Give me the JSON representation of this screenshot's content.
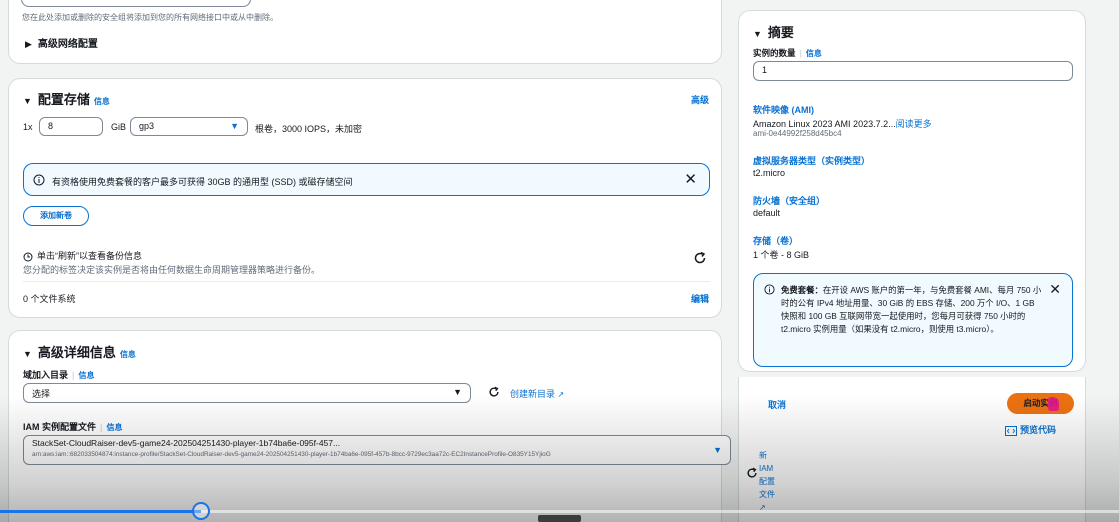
{
  "top_section": {
    "hint_text": "您在此处添加或删除的安全组将添加到您的所有网络接口中或从中删除。",
    "advanced_network_label": "高级网络配置"
  },
  "storage": {
    "title": "配置存储",
    "info": "信息",
    "advanced": "高级",
    "prefix": "1x",
    "size_value": "8",
    "unit": "GiB",
    "volume_type": "gp3",
    "volume_desc": "根卷，3000 IOPS，未加密",
    "alert_text": "有资格使用免费套餐的客户最多可获得 30GB 的通用型 (SSD) 或磁存储空间",
    "add_volume": "添加新卷",
    "backup_title": "单击“刷新”以查看备份信息",
    "backup_desc": "您分配的标签决定该实例是否将由任何数据生命周期管理器策略进行备份。",
    "fs_count": "0 个文件系统",
    "edit": "编辑"
  },
  "advanced_details": {
    "title": "高级详细信息",
    "info": "信息",
    "domain_label": "域加入目录",
    "domain_info": "信息",
    "domain_select": "选择",
    "create_dir": "创建新目录",
    "iam_label": "IAM 实例配置文件",
    "iam_info": "信息",
    "iam_value": "StackSet-CloudRaiser-dev5-game24-202504251430-player-1b74ba6e-095f-457...",
    "iam_arn": "arn:aws:iam::682033504874:instance-profile/StackSet-CloudRaiser-dev5-game24-202504251430-player-1b74ba6e-095f-457b-8bcc-9729ec3aa72c-EC2InstanceProfile-O835Y15YjioG",
    "new_iam_lines": [
      "新",
      "IAM",
      "配置",
      "文件"
    ]
  },
  "summary": {
    "title": "摘要",
    "instances_label": "实例的数量",
    "instances_info": "信息",
    "instances_value": "1",
    "software_label": "软件映像 (AMI)",
    "software_value": "Amazon Linux 2023 AMI 2023.7.2...",
    "read_more": "阅读更多",
    "ami_id": "ami-0e44992f258d45bc4",
    "server_type_label": "虚拟服务器类型（实例类型）",
    "server_type_value": "t2.micro",
    "firewall_label": "防火墙（安全组）",
    "firewall_value": "default",
    "storage_label": "存储（卷）",
    "storage_value": "1 个卷 - 8 GiB",
    "free_tier_bold": "免费套餐：",
    "free_tier_text": "在开设 AWS 账户的第一年，与免费套餐 AMI、每月 750 小时的公有 IPv4 地址用量、30 GiB 的 EBS 存储、200 万个 I/O、1 GB 快照和 100 GB 互联网带宽一起使用时，您每月可获得 750 小时的 t2.micro 实例用量（如果没有 t2.micro，则使用 t3.micro）。",
    "cancel": "取消",
    "launch": "启动实例",
    "preview_code": "预览代码"
  },
  "video_progress": 0.18,
  "colors": {
    "accent": "#0972d3",
    "launch": "#ec7211",
    "alert_bg": "#f1faff"
  }
}
